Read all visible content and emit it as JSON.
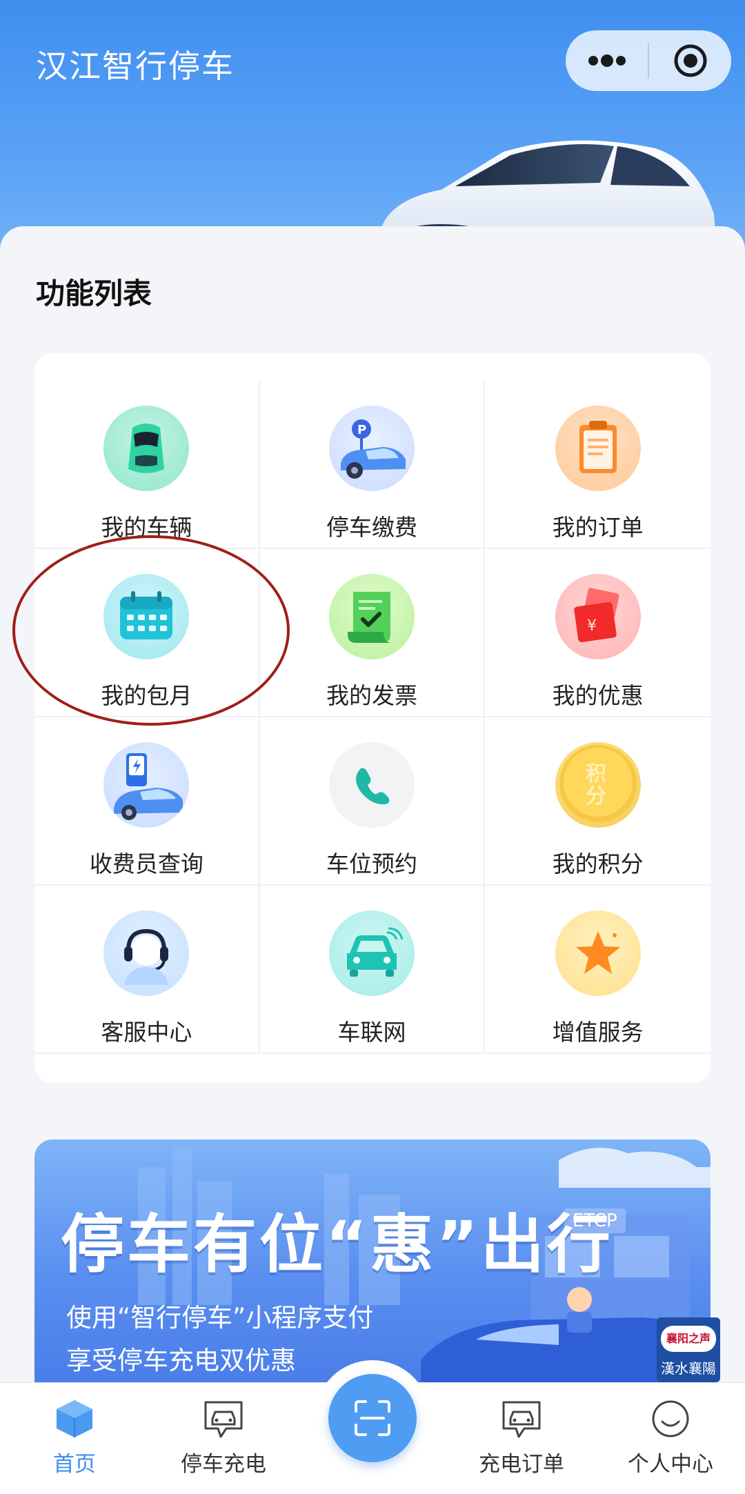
{
  "header": {
    "title": "汉江智行停车",
    "more_icon": "more-dots-icon",
    "close_icon": "target-circle-icon"
  },
  "features": {
    "title": "功能列表",
    "items": [
      {
        "label": "我的车辆",
        "icon": "car-top-icon"
      },
      {
        "label": "停车缴费",
        "icon": "parking-car-icon"
      },
      {
        "label": "我的订单",
        "icon": "clipboard-icon"
      },
      {
        "label": "我的包月",
        "icon": "calendar-icon"
      },
      {
        "label": "我的发票",
        "icon": "invoice-check-icon"
      },
      {
        "label": "我的优惠",
        "icon": "coupon-yen-icon"
      },
      {
        "label": "收费员查询",
        "icon": "charging-station-icon"
      },
      {
        "label": "车位预约",
        "icon": "phone-icon"
      },
      {
        "label": "我的积分",
        "icon": "points-coin-icon"
      },
      {
        "label": "客服中心",
        "icon": "headset-icon"
      },
      {
        "label": "车联网",
        "icon": "connected-car-icon"
      },
      {
        "label": "增值服务",
        "icon": "star-icon"
      }
    ]
  },
  "banner": {
    "headline": "停车有位“惠”出行",
    "line1": "使用“智行停车”小程序支付",
    "line2": "享受停车充电双优惠",
    "tag": "ETCP"
  },
  "watermark": {
    "top": "襄阳之声",
    "bottom": "漢水襄陽"
  },
  "tabbar": {
    "items": [
      {
        "label": "首页",
        "icon": "home-cube-icon",
        "active": true
      },
      {
        "label": "停车充电",
        "icon": "parking-charge-icon"
      },
      {
        "label": "",
        "icon": "scan-icon"
      },
      {
        "label": "充电订单",
        "icon": "charge-order-icon"
      },
      {
        "label": "个人中心",
        "icon": "profile-icon"
      }
    ]
  },
  "colors": {
    "primary": "#3d8fec",
    "header_top": "#3f8ff0",
    "highlight": "#9e1f17"
  }
}
